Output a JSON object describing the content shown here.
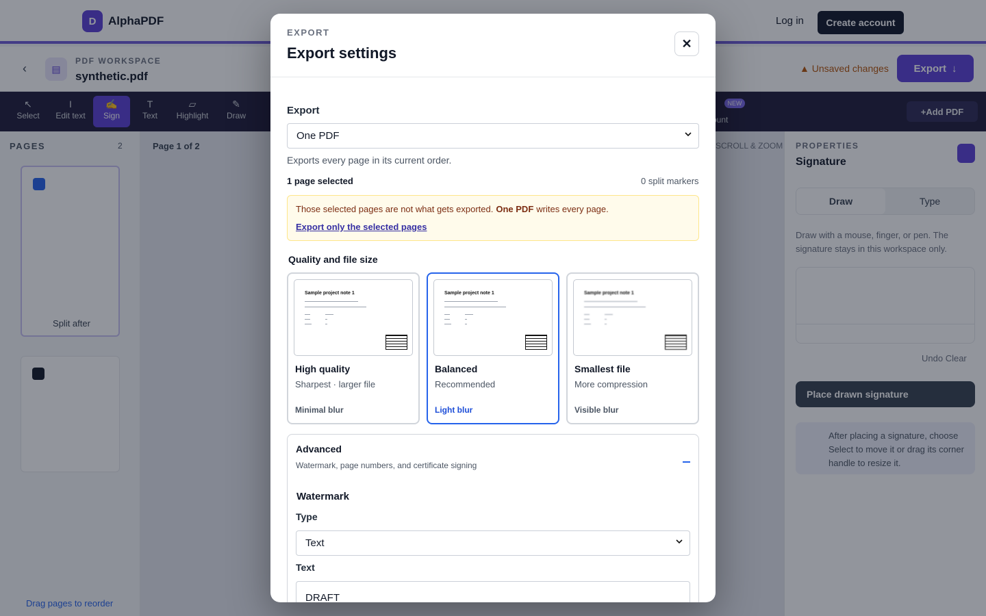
{
  "app": {
    "logo_initial": "D",
    "name": "AlphaPDF",
    "login": "Log in",
    "create_account": "Create account"
  },
  "docbar": {
    "workspace_label": "PDF WORKSPACE",
    "file_name": "synthetic.pdf",
    "unsaved": "Unsaved changes",
    "export": "Export"
  },
  "toolbar": {
    "tools": [
      {
        "label": "Select",
        "icon": "cursor-icon"
      },
      {
        "label": "Edit text",
        "icon": "text-cursor-icon"
      },
      {
        "label": "Sign",
        "icon": "signature-icon"
      },
      {
        "label": "Text",
        "icon": "type-icon"
      },
      {
        "label": "Highlight",
        "icon": "highlighter-icon"
      },
      {
        "label": "Draw",
        "icon": "pen-icon"
      }
    ],
    "new_badge": "NEW",
    "account": "ount",
    "add_pdf": "Add PDF"
  },
  "pages_panel": {
    "title": "PAGES",
    "count": "2",
    "split_after": "Split after",
    "drag_hint": "Drag pages to reorder"
  },
  "canvas": {
    "page_indicator": "Page 1 of 2",
    "hint": "SCROLL & ZOOM"
  },
  "properties": {
    "title": "PROPERTIES",
    "name": "Signature",
    "tab_draw": "Draw",
    "tab_type": "Type",
    "help": "Draw with a mouse, finger, or pen. The signature stays in this workspace only.",
    "undo_clear": "Undo   Clear",
    "place_button": "Place drawn signature",
    "tip": "After placing a signature, choose Select to move it or drag its corner handle to resize it."
  },
  "modal": {
    "eyebrow": "EXPORT",
    "title": "Export settings",
    "export_label": "Export",
    "export_value": "One PDF",
    "export_help": "Exports every page in its current order.",
    "selected_count": "1 page selected",
    "split_markers": "0 split markers",
    "warning_text": "Those selected pages are not what gets exported.",
    "warning_bold": "One PDF",
    "warning_tail": "writes every page.",
    "warning_link": "Export only the selected pages",
    "quality_label": "Quality and file size",
    "quality_options": [
      {
        "name": "High quality",
        "sub": "Sharpest · larger file",
        "blur": "Minimal blur",
        "selected": false
      },
      {
        "name": "Balanced",
        "sub": "Recommended",
        "blur": "Light blur",
        "selected": true
      },
      {
        "name": "Smallest file",
        "sub": "More compression",
        "blur": "Visible blur",
        "selected": false
      }
    ],
    "preview": {
      "title": "Sample project note 1"
    },
    "advanced_title": "Advanced",
    "advanced_sub": "Watermark, page numbers, and certificate signing",
    "watermark_title": "Watermark",
    "type_label": "Type",
    "type_value": "Text",
    "text_label": "Text",
    "text_value": "DRAFT"
  },
  "colors": {
    "accent": "#5b3fd6",
    "selected_border": "#2563eb",
    "warning_bg": "#fffbeb",
    "overlay": "rgba(17,24,39,0.46)"
  }
}
